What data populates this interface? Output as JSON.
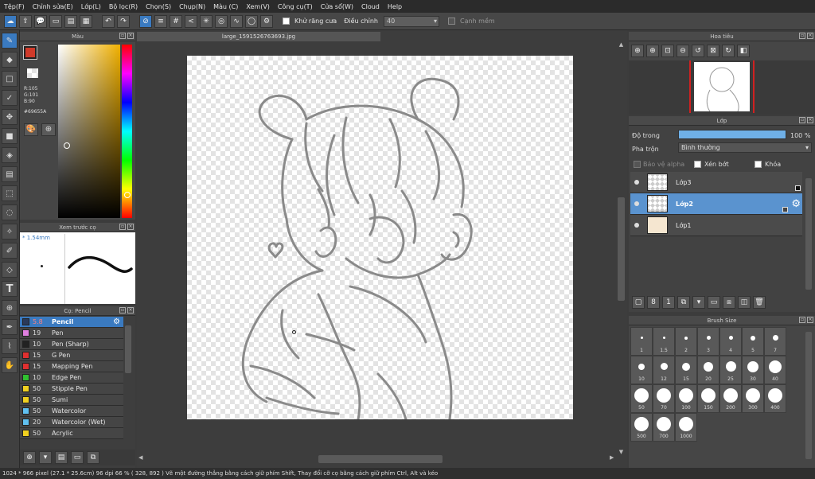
{
  "menu": [
    "Tệp(F)",
    "Chỉnh sửa(E)",
    "Lớp(L)",
    "Bộ lọc(R)",
    "Chọn(S)",
    "Chụp(N)",
    "Màu (C)",
    "Xem(V)",
    "Công cụ(T)",
    "Cửa sổ(W)",
    "Cloud",
    "Help"
  ],
  "toolbar": {
    "antialias_label": "Khử răng cưa",
    "adjust_label": "Điều chỉnh",
    "adjust_value": "40",
    "soft_edge_label": "Cạnh mềm"
  },
  "color_panel": {
    "title": "Màu",
    "r": "R:105",
    "g": "G:101",
    "b": "B:90",
    "hex": "#69655A",
    "color": "#69655a",
    "main_color": "#d03a2a"
  },
  "brush_preview": {
    "title": "Xem trước cọ",
    "size": "* 1.54mm"
  },
  "brush_panel": {
    "title": "Cọ: Pencil",
    "items": [
      {
        "size": "5.8",
        "name": "Pencil",
        "color": "#2a3a5a"
      },
      {
        "size": "19",
        "name": "Pen",
        "color": "#e080e0"
      },
      {
        "size": "10",
        "name": "Pen (Sharp)",
        "color": "#222222"
      },
      {
        "size": "15",
        "name": "G Pen",
        "color": "#e03030"
      },
      {
        "size": "15",
        "name": "Mapping Pen",
        "color": "#e03030"
      },
      {
        "size": "10",
        "name": "Edge Pen",
        "color": "#30c030"
      },
      {
        "size": "50",
        "name": "Stipple Pen",
        "color": "#f0d020"
      },
      {
        "size": "50",
        "name": "Sumi",
        "color": "#f0d020"
      },
      {
        "size": "50",
        "name": "Watercolor",
        "color": "#60c0f0"
      },
      {
        "size": "20",
        "name": "Watercolor (Wet)",
        "color": "#60c0f0"
      },
      {
        "size": "50",
        "name": "Acrylic",
        "color": "#f0d020"
      }
    ]
  },
  "canvas": {
    "tab": "large_1591526763693.jpg"
  },
  "navigator": {
    "title": "Hoa tiêu"
  },
  "layer_panel": {
    "title": "Lớp",
    "opacity_label": "Độ trong",
    "opacity_value": "100 %",
    "opacity_fraction": 1.0,
    "blend_label": "Pha trộn",
    "blend_value": "Bình thường",
    "protect_alpha": "Bảo vệ alpha",
    "clipping": "Xén bớt",
    "lock": "Khóa",
    "layers": [
      {
        "name": "Lớp3",
        "selected": false
      },
      {
        "name": "Lớp2",
        "selected": true
      },
      {
        "name": "Lớp1",
        "selected": false
      }
    ]
  },
  "brush_size": {
    "title": "Brush Size",
    "sizes": [
      "1",
      "1.5",
      "2",
      "3",
      "4",
      "5",
      "7",
      "10",
      "12",
      "15",
      "20",
      "25",
      "30",
      "40",
      "50",
      "70",
      "100",
      "150",
      "200",
      "300",
      "400",
      "500",
      "700",
      "1000"
    ]
  },
  "status": "1024 * 966 pixel  (27.1 * 25.6cm)  96 dpi  66 %  ( 328, 892 )  Vẽ một đường thẳng bằng cách giữ phím Shift, Thay đổi cỡ cọ bằng cách giữ phím Ctrl, Alt và kéo"
}
